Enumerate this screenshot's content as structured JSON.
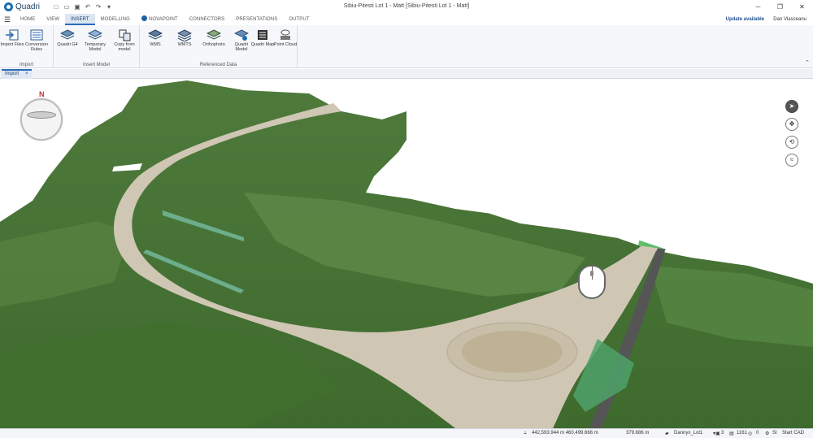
{
  "app": {
    "name": "Quadri",
    "window_title": "Sibiu-Pitesti Lot 1 - Matt [Sibiu-Pitesti Lot 1 - Matt]"
  },
  "tabs": [
    "HOME",
    "VIEW",
    "INSERT",
    "MODELLING",
    "NOVAPOINT",
    "CONNECTORS",
    "PRESENTATIONS",
    "OUTPUT"
  ],
  "active_tab": "INSERT",
  "update_label": "Update available",
  "user_name": "Dan Vlasceanu",
  "ribbon": {
    "groups": [
      {
        "label": "Import",
        "buttons": [
          "Import Files",
          "Conversion Rules"
        ]
      },
      {
        "label": "Insert Model",
        "buttons": [
          "Quadri G4",
          "Temporary Model",
          "Copy from model"
        ]
      },
      {
        "label": "Referenced Data",
        "buttons": [
          "WMS",
          "WMTS",
          "Orthophoto",
          "Quadri Model",
          "Quadri Map",
          "Point Cloud"
        ]
      }
    ]
  },
  "doc_tab": {
    "label": "Import",
    "close": "×"
  },
  "compass_label": "N",
  "status": {
    "coord_icon": "coordinate-icon",
    "coordinates": "442,593.944 m   460,499.666 m",
    "elevation": "379.686 m",
    "model": "Dannyx_Lot1",
    "count_a": "3",
    "count_b": "1161",
    "count_c": "0",
    "units": "SI",
    "start_cad": "Start CAD"
  },
  "colors": {
    "accent": "#2a6ab8",
    "brand": "#1a6fb0"
  }
}
